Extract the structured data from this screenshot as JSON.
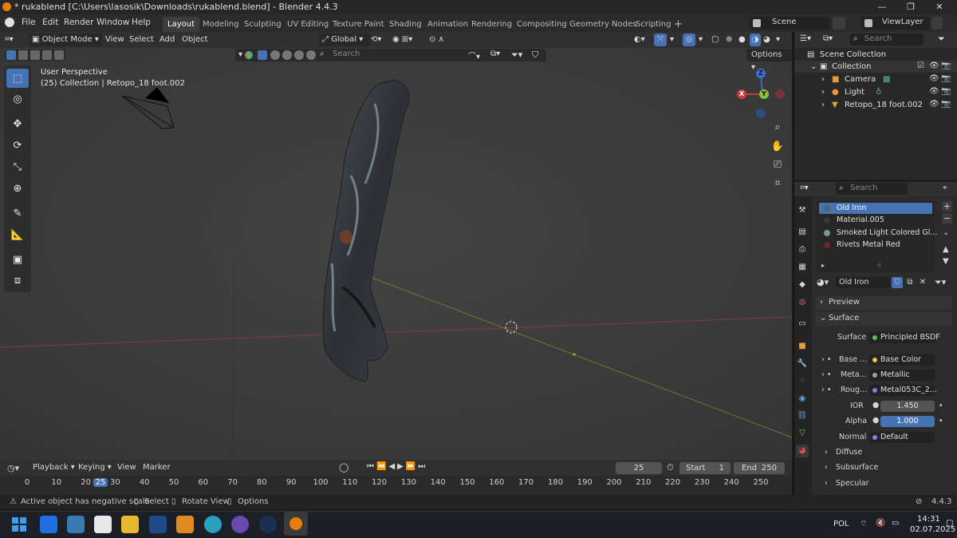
{
  "window": {
    "title": "* rukablend [C:\\Users\\lasosik\\Downloads\\rukablend.blend] - Blender 4.4.3",
    "controls": [
      "—",
      "❐",
      "✕"
    ]
  },
  "menu": {
    "items": [
      "File",
      "Edit",
      "Render",
      "Window",
      "Help"
    ],
    "workspaces": [
      "Layout",
      "Modeling",
      "Sculpting",
      "UV Editing",
      "Texture Paint",
      "Shading",
      "Animation",
      "Rendering",
      "Compositing",
      "Geometry Nodes",
      "Scripting"
    ],
    "active_workspace": "Layout",
    "add_workspace": "+",
    "scene": "Scene",
    "view_layer": "ViewLayer"
  },
  "viewport_header": {
    "mode": "Object Mode",
    "menus": [
      "View",
      "Select",
      "Add",
      "Object"
    ],
    "orientation": "Global",
    "search_placeholder": "Search",
    "options": "Options"
  },
  "viewport": {
    "perspective": "User Perspective",
    "collection_info": "(25) Collection | Retopo_18 foot.002",
    "gizmo": {
      "z": "Z",
      "y": "Y",
      "x": "X"
    }
  },
  "outliner": {
    "search_placeholder": "Search",
    "root": "Scene Collection",
    "items": [
      {
        "label": "Collection"
      },
      {
        "label": "Camera"
      },
      {
        "label": "Light"
      },
      {
        "label": "Retopo_18 foot.002"
      }
    ]
  },
  "properties": {
    "search_placeholder": "Search",
    "material_slots": [
      {
        "name": "Old Iron",
        "color": "#5a6270"
      },
      {
        "name": "Material.005",
        "color": "#3a3a3a"
      },
      {
        "name": "Smoked Light Colored Gl...",
        "color": "#7a9a90"
      },
      {
        "name": "Rivets Metal Red",
        "color": "#6a2a2a"
      }
    ],
    "material_name": "Old Iron",
    "panels": {
      "preview": "Preview",
      "surface": "Surface"
    },
    "fields": {
      "surface_label": "Surface",
      "surface_value": "Principled BSDF",
      "base_label": "Base ...",
      "base_value": "Base Color",
      "metal_label": "Meta...",
      "metal_value": "Metallic",
      "rough_label": "Roug...",
      "rough_value": "Metal053C_2...",
      "ior_label": "IOR",
      "ior_value": "1.450",
      "alpha_label": "Alpha",
      "alpha_value": "1.000",
      "normal_label": "Normal",
      "normal_value": "Default"
    },
    "subpanels": [
      "Diffuse",
      "Subsurface",
      "Specular"
    ]
  },
  "timeline": {
    "menus": [
      "Playback",
      "Keying",
      "View",
      "Marker"
    ],
    "current_frame": "25",
    "start_label": "Start",
    "start": "1",
    "end_label": "End",
    "end": "250",
    "ticks": [
      "0",
      "10",
      "20",
      "25",
      "30",
      "40",
      "50",
      "60",
      "70",
      "80",
      "90",
      "100",
      "110",
      "120",
      "130",
      "140",
      "150",
      "160",
      "170",
      "180",
      "190",
      "200",
      "210",
      "220",
      "230",
      "240",
      "250"
    ]
  },
  "statusbar": {
    "message": "Active object has negative scale",
    "select": "Select",
    "rotate": "Rotate View",
    "options": "Options",
    "version": "4.4.3"
  },
  "taskbar": {
    "language": "POL",
    "time": "14:31",
    "date": "02.07.2025"
  }
}
